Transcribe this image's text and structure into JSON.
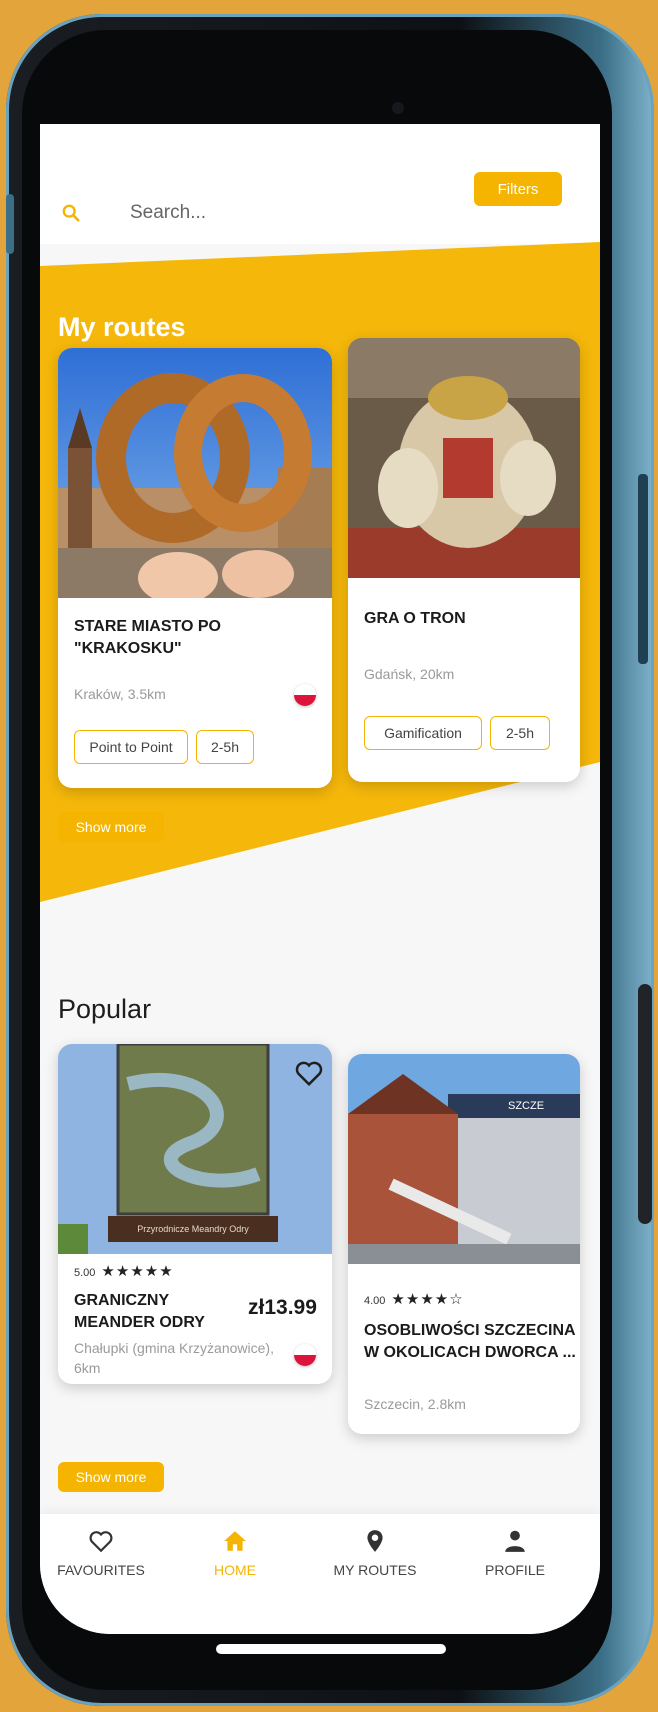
{
  "search": {
    "placeholder": "Search...",
    "filters_label": "Filters"
  },
  "my_routes": {
    "title": "My routes",
    "cards": [
      {
        "title": "STARE MIASTO PO \"KRAKOSKU\"",
        "location": "Kraków, 3.5km",
        "tags": [
          "Point to Point",
          "2-5h"
        ]
      },
      {
        "title": "GRA O TRON",
        "location": "Gdańsk, 20km",
        "tags": [
          "Gamification",
          "2-5h"
        ]
      }
    ],
    "show_more": "Show more"
  },
  "popular": {
    "title": "Popular",
    "cards": [
      {
        "rating": "5.00",
        "stars": 5,
        "title": "GRANICZNY MEANDER ODRY",
        "price": "zł13.99",
        "location": "Chałupki (gmina Krzyżanowice), 6km",
        "sign_text": "Przyrodnicze Meandry Odry"
      },
      {
        "rating": "4.00",
        "stars": 4,
        "title": "OSOBLIWOŚCI SZCZECINA W OKOLICACH DWORCA ...",
        "location": "Szczecin, 2.8km",
        "sign_text": "SZCZE"
      }
    ],
    "show_more": "Show more"
  },
  "nav": [
    {
      "label": "FAVOURITES",
      "icon": "heart-icon",
      "active": false
    },
    {
      "label": "HOME",
      "icon": "home-icon",
      "active": true
    },
    {
      "label": "MY ROUTES",
      "icon": "map-pin-icon",
      "active": false
    },
    {
      "label": "PROFILE",
      "icon": "user-icon",
      "active": false
    }
  ],
  "colors": {
    "accent": "#F4B400",
    "background": "#E2A43B"
  }
}
